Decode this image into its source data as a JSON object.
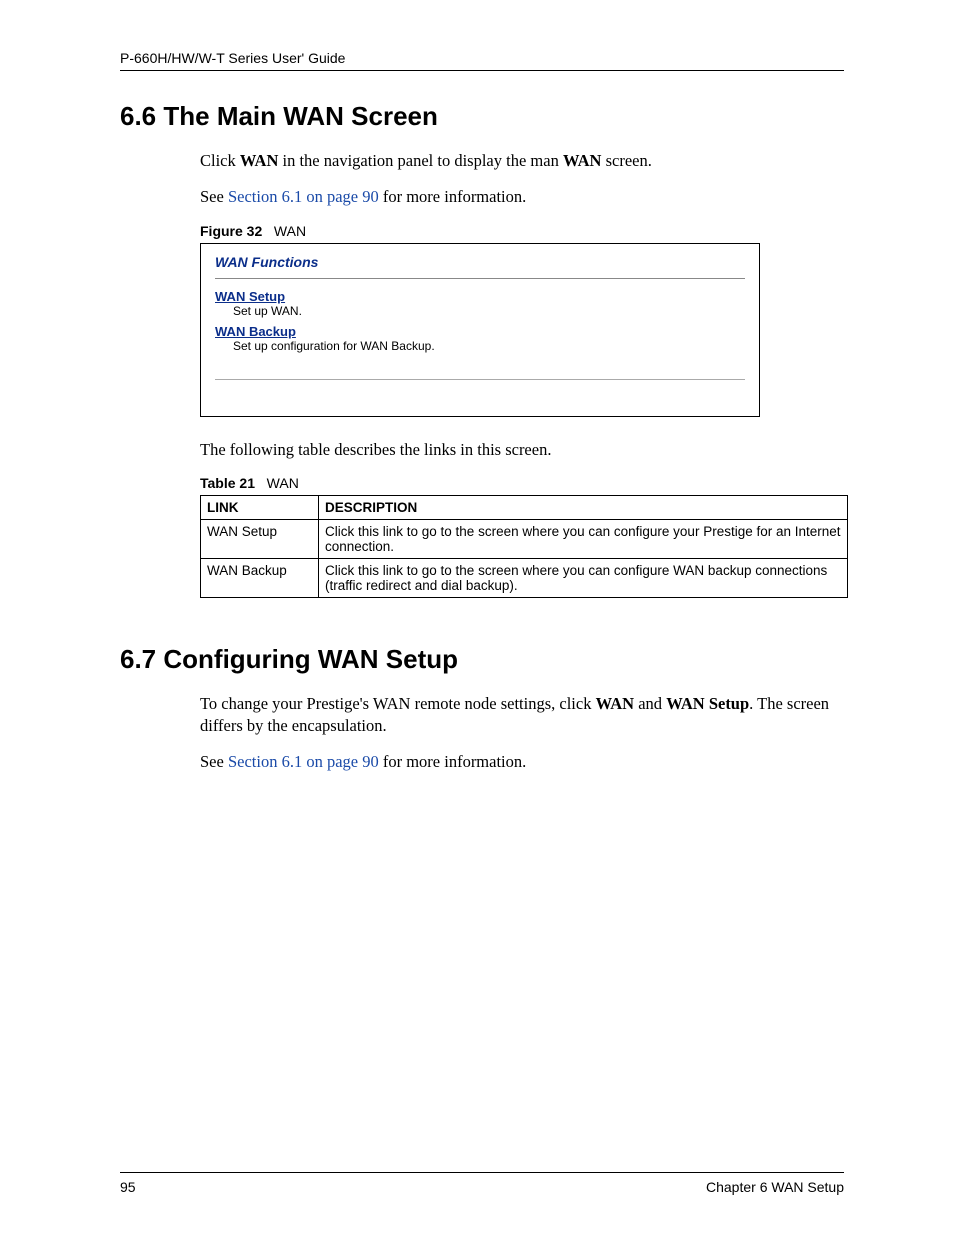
{
  "header": {
    "running_head": "P-660H/HW/W-T Series User' Guide"
  },
  "section66": {
    "title": "6.6  The Main WAN Screen",
    "p1_a": "Click ",
    "p1_b_bold": "WAN",
    "p1_c": " in the navigation panel to display the man ",
    "p1_d_bold": "WAN",
    "p1_e": " screen.",
    "p2_a": "See ",
    "p2_link": "Section 6.1 on page 90",
    "p2_b": " for more information.",
    "figure_label": "Figure 32",
    "figure_name": "WAN",
    "fig_title": "WAN Functions",
    "fig_link1": "WAN Setup",
    "fig_sub1": "Set up WAN.",
    "fig_link2": "WAN Backup",
    "fig_sub2": "Set up configuration for WAN Backup.",
    "table_intro": "The following table describes the links in this screen.",
    "table_label": "Table 21",
    "table_name": "WAN",
    "table": {
      "head_link": "LINK",
      "head_desc": "DESCRIPTION",
      "rows": [
        {
          "link": "WAN Setup",
          "desc": "Click this link to go to the screen where you can configure your Prestige for an Internet connection."
        },
        {
          "link": "WAN Backup",
          "desc": "Click this link to go to the screen where you can configure WAN backup connections (traffic redirect and dial backup)."
        }
      ]
    }
  },
  "section67": {
    "title": "6.7  Configuring WAN Setup",
    "p1_a": "To change your Prestige's WAN remote node settings, click ",
    "p1_b_bold": "WAN",
    "p1_c": " and ",
    "p1_d_bold": "WAN Setup",
    "p1_e": ". The screen differs by the encapsulation.",
    "p2_a": "See ",
    "p2_link": "Section 6.1 on page 90",
    "p2_b": " for more information."
  },
  "footer": {
    "page_number": "95",
    "chapter": "Chapter 6 WAN Setup"
  }
}
